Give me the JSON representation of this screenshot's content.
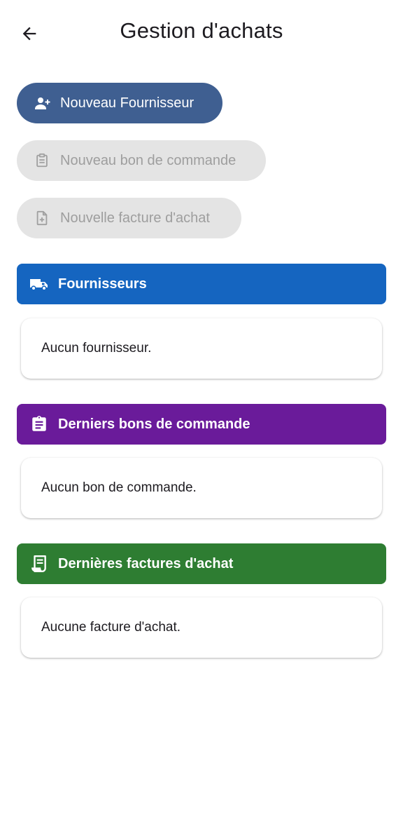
{
  "appbar": {
    "title": "Gestion d'achats",
    "back_icon": "arrow-back-icon"
  },
  "actions": {
    "new_supplier": {
      "label": "Nouveau Fournisseur",
      "icon": "person-add-icon",
      "enabled": true
    },
    "new_purchase_order": {
      "label": "Nouveau bon de commande",
      "icon": "clipboard-icon",
      "enabled": false
    },
    "new_purchase_invoice": {
      "label": "Nouvelle facture d'achat",
      "icon": "file-add-icon",
      "enabled": false
    }
  },
  "sections": {
    "suppliers": {
      "title": "Fournisseurs",
      "empty_text": "Aucun fournisseur.",
      "color": "#1565c0",
      "icon": "truck-icon"
    },
    "purchase_orders": {
      "title": "Derniers bons de commande",
      "empty_text": "Aucun bon de commande.",
      "color": "#6a1b9a",
      "icon": "assignment-icon"
    },
    "purchase_invoices": {
      "title": "Dernières factures d'achat",
      "empty_text": "Aucune facture d'achat.",
      "color": "#2e7d32",
      "icon": "receipt-icon"
    }
  },
  "colors": {
    "primary_button": "#3f5f91",
    "disabled_button": "#e4e4e4",
    "disabled_text": "#9e9e9e"
  }
}
